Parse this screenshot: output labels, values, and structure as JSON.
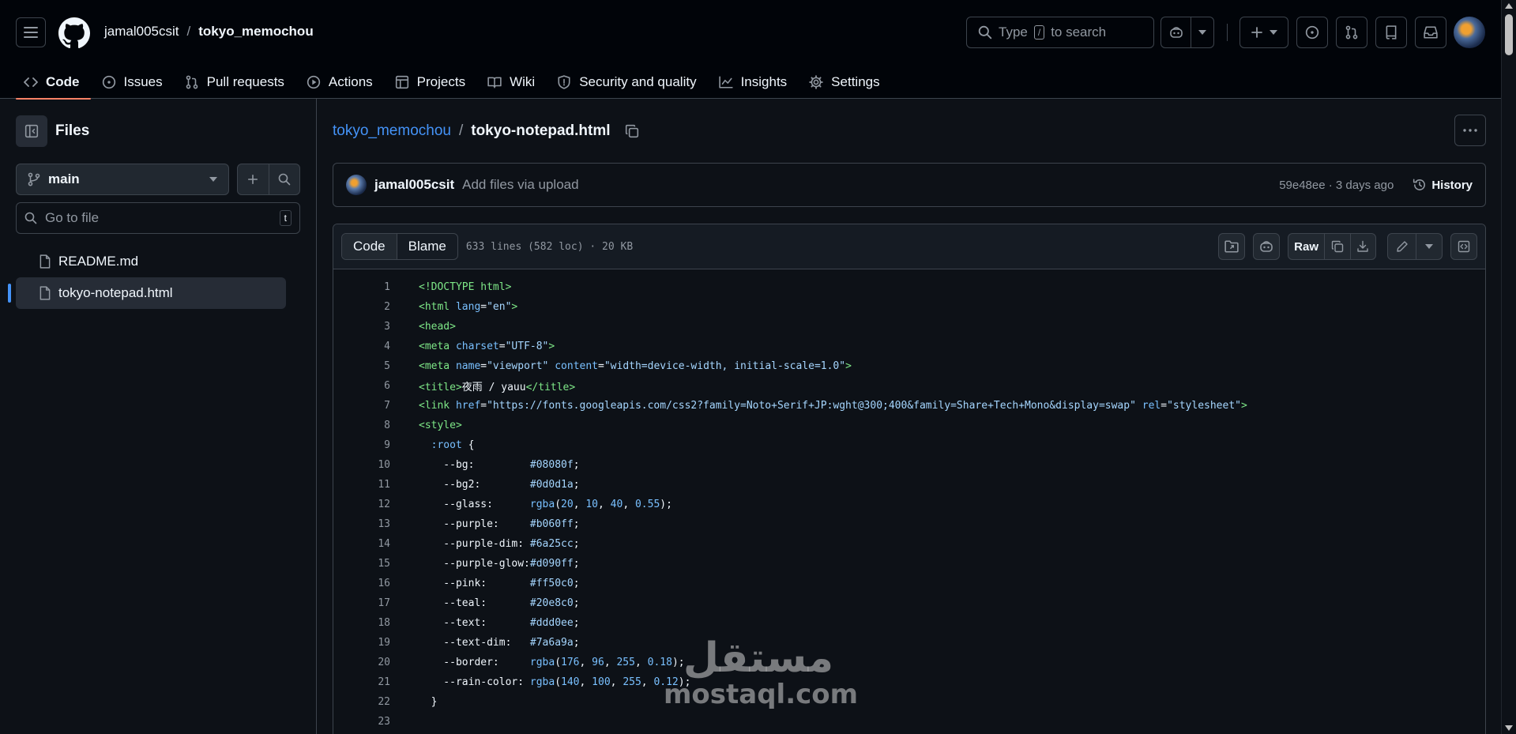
{
  "header": {
    "owner": "jamal005csit",
    "separator": "/",
    "repo": "tokyo_memochou",
    "search_prefix": "Type",
    "search_key": "/",
    "search_suffix": "to search"
  },
  "tabs": [
    {
      "label": "Code",
      "icon": "code-icon"
    },
    {
      "label": "Issues",
      "icon": "issue-icon"
    },
    {
      "label": "Pull requests",
      "icon": "pull-request-icon"
    },
    {
      "label": "Actions",
      "icon": "play-icon"
    },
    {
      "label": "Projects",
      "icon": "table-icon"
    },
    {
      "label": "Wiki",
      "icon": "book-icon"
    },
    {
      "label": "Security and quality",
      "icon": "shield-icon"
    },
    {
      "label": "Insights",
      "icon": "graph-icon"
    },
    {
      "label": "Settings",
      "icon": "gear-icon"
    }
  ],
  "sidebar": {
    "title": "Files",
    "branch": "main",
    "goto_placeholder": "Go to file",
    "goto_key": "t",
    "files": [
      {
        "name": "README.md",
        "active": false
      },
      {
        "name": "tokyo-notepad.html",
        "active": true
      }
    ]
  },
  "main": {
    "repo_link": "tokyo_memochou",
    "separator": "/",
    "file_name": "tokyo-notepad.html",
    "commit": {
      "author": "jamal005csit",
      "message": "Add files via upload",
      "meta": "59e48ee · 3 days ago",
      "history_label": "History"
    },
    "viewer": {
      "code_tab": "Code",
      "blame_tab": "Blame",
      "info": "633 lines (582 loc) · 20 KB",
      "raw_label": "Raw"
    },
    "code_lines": [
      [
        [
          "t-tag",
          "<!DOCTYPE html>"
        ]
      ],
      [
        [
          "t-tag",
          "<html"
        ],
        [
          "t-plain",
          " "
        ],
        [
          "t-attr",
          "lang"
        ],
        [
          "t-plain",
          "="
        ],
        [
          "t-str",
          "\"en\""
        ],
        [
          "t-tag",
          ">"
        ]
      ],
      [
        [
          "t-tag",
          "<head>"
        ]
      ],
      [
        [
          "t-tag",
          "<meta"
        ],
        [
          "t-plain",
          " "
        ],
        [
          "t-attr",
          "charset"
        ],
        [
          "t-plain",
          "="
        ],
        [
          "t-str",
          "\"UTF-8\""
        ],
        [
          "t-tag",
          ">"
        ]
      ],
      [
        [
          "t-tag",
          "<meta"
        ],
        [
          "t-plain",
          " "
        ],
        [
          "t-attr",
          "name"
        ],
        [
          "t-plain",
          "="
        ],
        [
          "t-str",
          "\"viewport\""
        ],
        [
          "t-plain",
          " "
        ],
        [
          "t-attr",
          "content"
        ],
        [
          "t-plain",
          "="
        ],
        [
          "t-str",
          "\"width=device-width, initial-scale=1.0\""
        ],
        [
          "t-tag",
          ">"
        ]
      ],
      [
        [
          "t-tag",
          "<title>"
        ],
        [
          "t-plain",
          "夜雨 / yauu"
        ],
        [
          "t-tag",
          "</title>"
        ]
      ],
      [
        [
          "t-tag",
          "<link"
        ],
        [
          "t-plain",
          " "
        ],
        [
          "t-attr",
          "href"
        ],
        [
          "t-plain",
          "="
        ],
        [
          "t-str",
          "\"https://fonts.googleapis.com/css2?family=Noto+Serif+JP:wght@300;400&family=Share+Tech+Mono&display=swap\""
        ],
        [
          "t-plain",
          " "
        ],
        [
          "t-attr",
          "rel"
        ],
        [
          "t-plain",
          "="
        ],
        [
          "t-str",
          "\"stylesheet\""
        ],
        [
          "t-tag",
          ">"
        ]
      ],
      [
        [
          "t-tag",
          "<style>"
        ]
      ],
      [
        [
          "t-plain",
          "  "
        ],
        [
          "t-fn",
          ":root"
        ],
        [
          "t-plain",
          " {"
        ]
      ],
      [
        [
          "t-plain",
          "    --bg:         "
        ],
        [
          "t-str",
          "#08080f"
        ],
        [
          "t-plain",
          ";"
        ]
      ],
      [
        [
          "t-plain",
          "    --bg2:        "
        ],
        [
          "t-str",
          "#0d0d1a"
        ],
        [
          "t-plain",
          ";"
        ]
      ],
      [
        [
          "t-plain",
          "    --glass:      "
        ],
        [
          "t-fn",
          "rgba"
        ],
        [
          "t-plain",
          "("
        ],
        [
          "t-num",
          "20"
        ],
        [
          "t-plain",
          ", "
        ],
        [
          "t-num",
          "10"
        ],
        [
          "t-plain",
          ", "
        ],
        [
          "t-num",
          "40"
        ],
        [
          "t-plain",
          ", "
        ],
        [
          "t-num",
          "0.55"
        ],
        [
          "t-plain",
          ");"
        ]
      ],
      [
        [
          "t-plain",
          "    --purple:     "
        ],
        [
          "t-str",
          "#b060ff"
        ],
        [
          "t-plain",
          ";"
        ]
      ],
      [
        [
          "t-plain",
          "    --purple-dim: "
        ],
        [
          "t-str",
          "#6a25cc"
        ],
        [
          "t-plain",
          ";"
        ]
      ],
      [
        [
          "t-plain",
          "    --purple-glow:"
        ],
        [
          "t-str",
          "#d090ff"
        ],
        [
          "t-plain",
          ";"
        ]
      ],
      [
        [
          "t-plain",
          "    --pink:       "
        ],
        [
          "t-str",
          "#ff50c0"
        ],
        [
          "t-plain",
          ";"
        ]
      ],
      [
        [
          "t-plain",
          "    --teal:       "
        ],
        [
          "t-str",
          "#20e8c0"
        ],
        [
          "t-plain",
          ";"
        ]
      ],
      [
        [
          "t-plain",
          "    --text:       "
        ],
        [
          "t-str",
          "#ddd0ee"
        ],
        [
          "t-plain",
          ";"
        ]
      ],
      [
        [
          "t-plain",
          "    --text-dim:   "
        ],
        [
          "t-str",
          "#7a6a9a"
        ],
        [
          "t-plain",
          ";"
        ]
      ],
      [
        [
          "t-plain",
          "    --border:     "
        ],
        [
          "t-fn",
          "rgba"
        ],
        [
          "t-plain",
          "("
        ],
        [
          "t-num",
          "176"
        ],
        [
          "t-plain",
          ", "
        ],
        [
          "t-num",
          "96"
        ],
        [
          "t-plain",
          ", "
        ],
        [
          "t-num",
          "255"
        ],
        [
          "t-plain",
          ", "
        ],
        [
          "t-num",
          "0.18"
        ],
        [
          "t-plain",
          ");"
        ]
      ],
      [
        [
          "t-plain",
          "    --rain-color: "
        ],
        [
          "t-fn",
          "rgba"
        ],
        [
          "t-plain",
          "("
        ],
        [
          "t-num",
          "140"
        ],
        [
          "t-plain",
          ", "
        ],
        [
          "t-num",
          "100"
        ],
        [
          "t-plain",
          ", "
        ],
        [
          "t-num",
          "255"
        ],
        [
          "t-plain",
          ", "
        ],
        [
          "t-num",
          "0.12"
        ],
        [
          "t-plain",
          ");"
        ]
      ],
      [
        [
          "t-plain",
          "  }"
        ]
      ],
      [
        [
          "t-plain",
          ""
        ]
      ]
    ]
  },
  "watermark": {
    "arabic": "مستقل",
    "latin": "mostaql.com"
  },
  "colors": {
    "accent_tab": "#f78166",
    "link": "#4493f8",
    "background": "#0d1117",
    "header_bg": "#010409"
  }
}
